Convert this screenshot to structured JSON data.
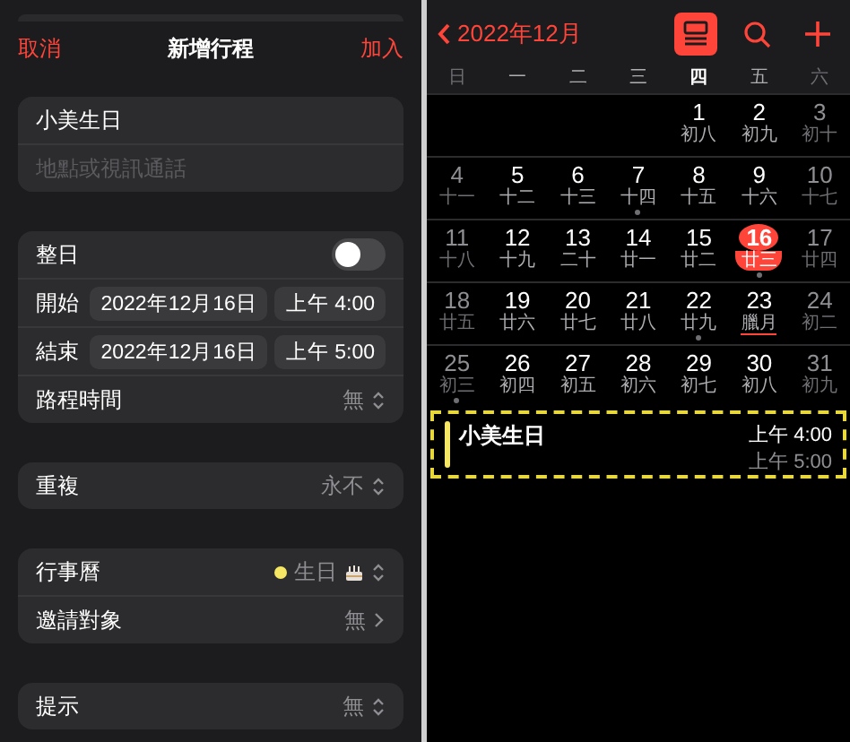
{
  "add_event": {
    "cancel": "取消",
    "title": "新增行程",
    "add": "加入",
    "event_title": "小美生日",
    "location": {
      "placeholder": "地點或視訊通話"
    },
    "sections": [
      [
        {
          "kind": "toggle",
          "label": "整日",
          "on": false
        },
        {
          "kind": "datetime",
          "label": "開始",
          "date": "2022年12月16日",
          "time": "上午 4:00"
        },
        {
          "kind": "datetime",
          "label": "結束",
          "date": "2022年12月16日",
          "time": "上午 5:00"
        },
        {
          "kind": "popup",
          "label": "路程時間",
          "value": "無"
        }
      ],
      [
        {
          "kind": "popup",
          "label": "重複",
          "value": "永不"
        }
      ],
      [
        {
          "kind": "calendar",
          "label": "行事曆",
          "value": "生日",
          "color": "#f5e663"
        },
        {
          "kind": "link",
          "label": "邀請對象",
          "value": "無"
        }
      ],
      [
        {
          "kind": "popup",
          "label": "提示",
          "value": "無"
        }
      ]
    ]
  },
  "calendar": {
    "month": "2022年12月",
    "list_view": {
      "on": true
    },
    "weekdays": [
      {
        "label": "日",
        "weekend": true,
        "today": false
      },
      {
        "label": "一",
        "weekend": false,
        "today": false
      },
      {
        "label": "二",
        "weekend": false,
        "today": false
      },
      {
        "label": "三",
        "weekend": false,
        "today": false
      },
      {
        "label": "四",
        "weekend": false,
        "today": true
      },
      {
        "label": "五",
        "weekend": false,
        "today": false
      },
      {
        "label": "六",
        "weekend": true,
        "today": false
      }
    ],
    "weeks": [
      [
        {
          "kind": "blank"
        },
        {
          "kind": "blank"
        },
        {
          "kind": "blank"
        },
        {
          "kind": "blank"
        },
        {
          "kind": "day",
          "day": "1",
          "lunar": "初八",
          "weekend": false,
          "selected": false,
          "has_event": false,
          "holiday": false
        },
        {
          "kind": "day",
          "day": "2",
          "lunar": "初九",
          "weekend": false,
          "selected": false,
          "has_event": false,
          "holiday": false
        },
        {
          "kind": "day",
          "day": "3",
          "lunar": "初十",
          "weekend": true,
          "selected": false,
          "has_event": false,
          "holiday": false
        }
      ],
      [
        {
          "kind": "day",
          "day": "4",
          "lunar": "十一",
          "weekend": true,
          "selected": false,
          "has_event": false,
          "holiday": false
        },
        {
          "kind": "day",
          "day": "5",
          "lunar": "十二",
          "weekend": false,
          "selected": false,
          "has_event": false,
          "holiday": false
        },
        {
          "kind": "day",
          "day": "6",
          "lunar": "十三",
          "weekend": false,
          "selected": false,
          "has_event": false,
          "holiday": false
        },
        {
          "kind": "day",
          "day": "7",
          "lunar": "十四",
          "weekend": false,
          "selected": false,
          "has_event": true,
          "holiday": false
        },
        {
          "kind": "day",
          "day": "8",
          "lunar": "十五",
          "weekend": false,
          "selected": false,
          "has_event": false,
          "holiday": false
        },
        {
          "kind": "day",
          "day": "9",
          "lunar": "十六",
          "weekend": false,
          "selected": false,
          "has_event": false,
          "holiday": false
        },
        {
          "kind": "day",
          "day": "10",
          "lunar": "十七",
          "weekend": true,
          "selected": false,
          "has_event": false,
          "holiday": false
        }
      ],
      [
        {
          "kind": "day",
          "day": "11",
          "lunar": "十八",
          "weekend": true,
          "selected": false,
          "has_event": false,
          "holiday": false
        },
        {
          "kind": "day",
          "day": "12",
          "lunar": "十九",
          "weekend": false,
          "selected": false,
          "has_event": false,
          "holiday": false
        },
        {
          "kind": "day",
          "day": "13",
          "lunar": "二十",
          "weekend": false,
          "selected": false,
          "has_event": false,
          "holiday": false
        },
        {
          "kind": "day",
          "day": "14",
          "lunar": "廿一",
          "weekend": false,
          "selected": false,
          "has_event": false,
          "holiday": false
        },
        {
          "kind": "day",
          "day": "15",
          "lunar": "廿二",
          "weekend": false,
          "selected": false,
          "has_event": false,
          "holiday": false
        },
        {
          "kind": "day",
          "day": "16",
          "lunar": "廿三",
          "weekend": false,
          "selected": true,
          "has_event": true,
          "holiday": false
        },
        {
          "kind": "day",
          "day": "17",
          "lunar": "廿四",
          "weekend": true,
          "selected": false,
          "has_event": false,
          "holiday": false
        }
      ],
      [
        {
          "kind": "day",
          "day": "18",
          "lunar": "廿五",
          "weekend": true,
          "selected": false,
          "has_event": false,
          "holiday": false
        },
        {
          "kind": "day",
          "day": "19",
          "lunar": "廿六",
          "weekend": false,
          "selected": false,
          "has_event": false,
          "holiday": false
        },
        {
          "kind": "day",
          "day": "20",
          "lunar": "廿七",
          "weekend": false,
          "selected": false,
          "has_event": false,
          "holiday": false
        },
        {
          "kind": "day",
          "day": "21",
          "lunar": "廿八",
          "weekend": false,
          "selected": false,
          "has_event": false,
          "holiday": false
        },
        {
          "kind": "day",
          "day": "22",
          "lunar": "廿九",
          "weekend": false,
          "selected": false,
          "has_event": true,
          "holiday": false
        },
        {
          "kind": "day",
          "day": "23",
          "lunar": "臘月",
          "weekend": false,
          "selected": false,
          "has_event": false,
          "holiday": true
        },
        {
          "kind": "day",
          "day": "24",
          "lunar": "初二",
          "weekend": true,
          "selected": false,
          "has_event": false,
          "holiday": false
        }
      ],
      [
        {
          "kind": "day",
          "day": "25",
          "lunar": "初三",
          "weekend": true,
          "selected": false,
          "has_event": true,
          "holiday": false
        },
        {
          "kind": "day",
          "day": "26",
          "lunar": "初四",
          "weekend": false,
          "selected": false,
          "has_event": false,
          "holiday": false
        },
        {
          "kind": "day",
          "day": "27",
          "lunar": "初五",
          "weekend": false,
          "selected": false,
          "has_event": false,
          "holiday": false
        },
        {
          "kind": "day",
          "day": "28",
          "lunar": "初六",
          "weekend": false,
          "selected": false,
          "has_event": false,
          "holiday": false
        },
        {
          "kind": "day",
          "day": "29",
          "lunar": "初七",
          "weekend": false,
          "selected": false,
          "has_event": false,
          "holiday": false
        },
        {
          "kind": "day",
          "day": "30",
          "lunar": "初八",
          "weekend": false,
          "selected": false,
          "has_event": false,
          "holiday": false
        },
        {
          "kind": "day",
          "day": "31",
          "lunar": "初九",
          "weekend": true,
          "selected": false,
          "has_event": false,
          "holiday": false
        }
      ]
    ],
    "events": [
      {
        "title": "小美生日",
        "start": "上午 4:00",
        "end": "上午 5:00",
        "color": "#f5e663"
      }
    ]
  }
}
